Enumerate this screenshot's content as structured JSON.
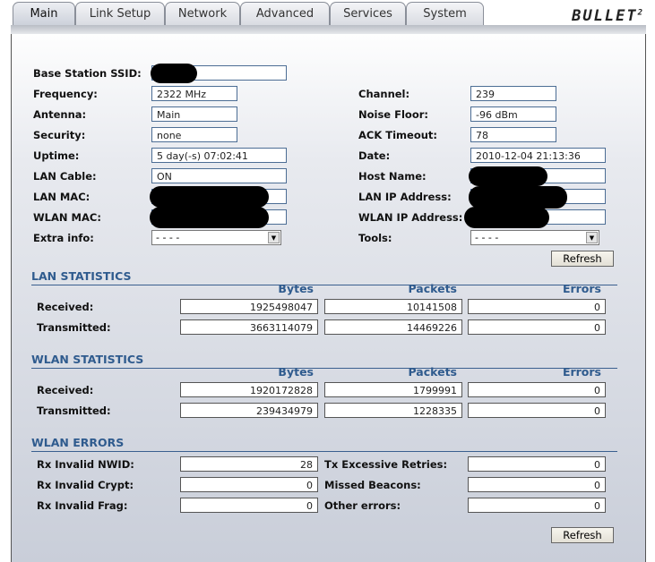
{
  "tabs": [
    "Main",
    "Link Setup",
    "Network",
    "Advanced",
    "Services",
    "System"
  ],
  "logo": {
    "text": "BULLET",
    "sup": "2"
  },
  "status": {
    "ssid_label": "Base Station SSID:",
    "frequency_label": "Frequency:",
    "frequency": "2322 MHz",
    "channel_label": "Channel:",
    "channel": "239",
    "antenna_label": "Antenna:",
    "antenna": "Main",
    "noise_label": "Noise Floor:",
    "noise": "-96 dBm",
    "security_label": "Security:",
    "security": "none",
    "ack_label": "ACK Timeout:",
    "ack": "78",
    "uptime_label": "Uptime:",
    "uptime": "5 day(-s) 07:02:41",
    "date_label": "Date:",
    "date": "2010-12-04 21:13:36",
    "lancable_label": "LAN Cable:",
    "lancable": "ON",
    "hostname_label": "Host Name:",
    "lanmac_label": "LAN MAC:",
    "lanip_label": "LAN IP Address:",
    "wlanmac_label": "WLAN MAC:",
    "wlanip_label": "WLAN IP Address:",
    "extra_label": "Extra info:",
    "extra_value": "- - - -",
    "tools_label": "Tools:",
    "tools_value": "- - - -",
    "refresh": "Refresh"
  },
  "columns": [
    "Bytes",
    "Packets",
    "Errors"
  ],
  "lan": {
    "title": "LAN STATISTICS",
    "rows": [
      {
        "label": "Received:",
        "values": [
          "1925498047",
          "10141508",
          "0"
        ]
      },
      {
        "label": "Transmitted:",
        "values": [
          "3663114079",
          "14469226",
          "0"
        ]
      }
    ]
  },
  "wlan": {
    "title": "WLAN STATISTICS",
    "rows": [
      {
        "label": "Received:",
        "values": [
          "1920172828",
          "1799991",
          "0"
        ]
      },
      {
        "label": "Transmitted:",
        "values": [
          "239434979",
          "1228335",
          "0"
        ]
      }
    ]
  },
  "errors": {
    "title": "WLAN ERRORS",
    "rows": [
      {
        "label": "Rx Invalid NWID:",
        "value": "28",
        "label2": "Tx Excessive Retries:",
        "value2": "0"
      },
      {
        "label": "Rx Invalid Crypt:",
        "value": "0",
        "label2": "Missed Beacons:",
        "value2": "0"
      },
      {
        "label": "Rx Invalid Frag:",
        "value": "0",
        "label2": "Other errors:",
        "value2": "0"
      }
    ]
  },
  "refresh_bottom": "Refresh"
}
